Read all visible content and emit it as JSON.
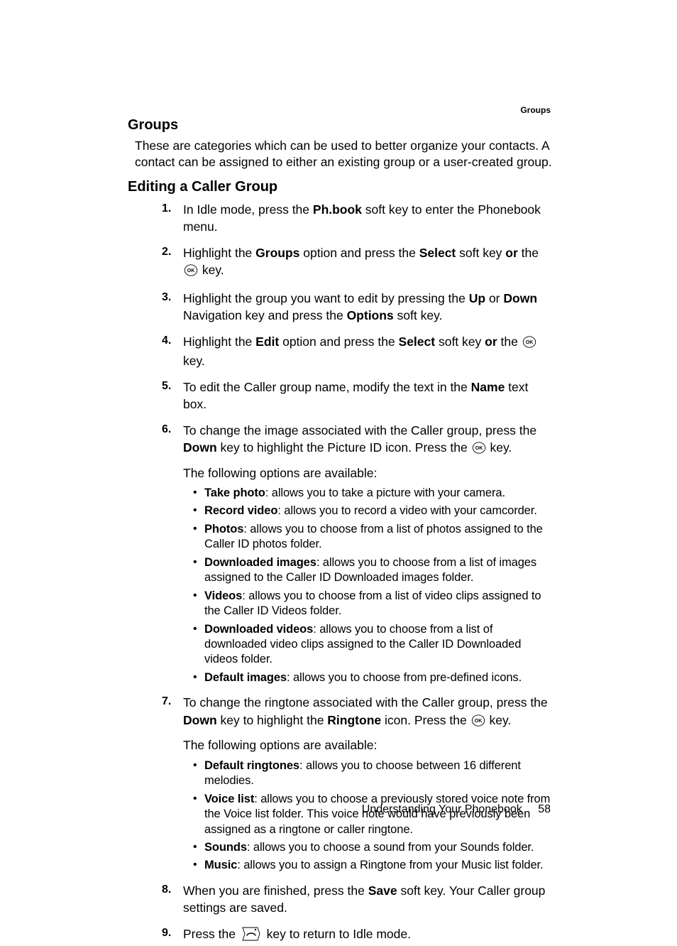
{
  "running_head": "Groups",
  "section1": {
    "title": "Groups",
    "para": "These are categories which can be used to better organize your contacts. A contact can be assigned to either an existing group or a user-created group."
  },
  "section2": {
    "title": "Editing a Caller Group",
    "step1": {
      "num": "1.",
      "t1": "In Idle mode, press the ",
      "b1": "Ph.book",
      "t2": " soft key to enter the Phonebook menu."
    },
    "step2": {
      "num": "2.",
      "t1": "Highlight the ",
      "b1": "Groups",
      "t2": " option and press the ",
      "b2": "Select",
      "t3": " soft key ",
      "b3": "or",
      "t4": " the ",
      "t5": " key."
    },
    "step3": {
      "num": "3.",
      "t1": "Highlight the group you want to edit by pressing the ",
      "b1": "Up",
      "t2": " or ",
      "b2": "Down",
      "t3": " Navigation key and press the ",
      "b3": "Options",
      "t4": " soft key."
    },
    "step4": {
      "num": "4.",
      "t1": "Highlight the ",
      "b1": "Edit",
      "t2": " option and press the ",
      "b2": "Select",
      "t3": " soft key ",
      "b3": "or",
      "t4": " the ",
      "t5": " key."
    },
    "step5": {
      "num": "5.",
      "t1": "To edit the Caller group name, modify the text in the ",
      "b1": "Name",
      "t2": " text box."
    },
    "step6": {
      "num": "6.",
      "t1": "To change the image associated with the Caller group, press the ",
      "b1": "Down",
      "t2": " key to highlight the Picture ID icon. Press the ",
      "t3": " key.",
      "follow": "The following options are available:",
      "opts": {
        "o1": {
          "b": "Take photo",
          "t": ": allows you to take a picture with your camera."
        },
        "o2": {
          "b": "Record video",
          "t": ": allows you to record a video with your camcorder."
        },
        "o3": {
          "b": "Photos",
          "t": ": allows you to choose from a list of photos assigned to the Caller ID photos folder."
        },
        "o4": {
          "b": "Downloaded images",
          "t": ": allows you to choose from a list of images assigned to the Caller ID Downloaded images folder."
        },
        "o5": {
          "b": "Videos",
          "t": ": allows you to choose from a list of video clips assigned to the Caller ID Videos folder."
        },
        "o6": {
          "b": "Downloaded videos",
          "t": ": allows you to choose from a list of downloaded video clips assigned to the Caller ID Downloaded videos folder."
        },
        "o7": {
          "b": "Default images",
          "t": ": allows you to choose from pre-defined icons."
        }
      }
    },
    "step7": {
      "num": "7.",
      "t1": "To change the ringtone associated with the Caller group, press the ",
      "b1": "Down",
      "t2": " key to highlight the ",
      "b2": "Ringtone",
      "t3": " icon. Press the ",
      "t4": " key.",
      "follow": "The following options are available:",
      "opts": {
        "o1": {
          "b": "Default ringtones",
          "t": ": allows you to choose between 16 different melodies."
        },
        "o2": {
          "b": "Voice list",
          "t": ": allows you to choose a previously stored voice note from the Voice list folder. This voice note would have previously been assigned as a ringtone or caller ringtone."
        },
        "o3": {
          "b": "Sounds",
          "t": ": allows you to choose a sound from your Sounds folder."
        },
        "o4": {
          "b": "Music",
          "t": ": allows you to assign a Ringtone from your Music list folder."
        }
      }
    },
    "step8": {
      "num": "8.",
      "t1": "When you are finished, press the ",
      "b1": "Save",
      "t2": " soft key. Your Caller group settings are saved."
    },
    "step9": {
      "num": "9.",
      "t1": "Press the ",
      "t2": " key to return to Idle mode."
    }
  },
  "footer": {
    "chapter": "Understanding Your Phonebook",
    "page": "58"
  }
}
